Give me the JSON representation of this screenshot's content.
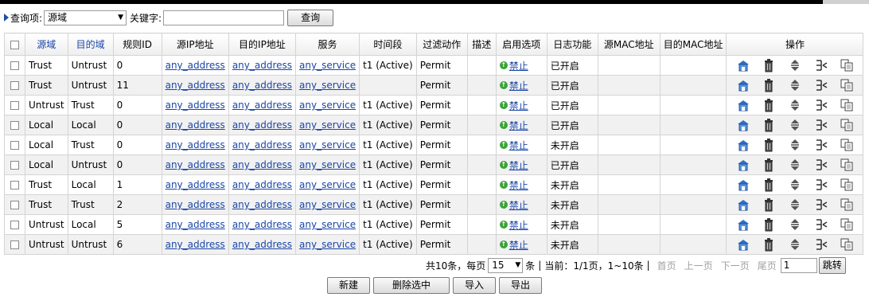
{
  "query": {
    "label": "查询项:",
    "field_value": "源域",
    "keyword_label": "关键字:",
    "keyword_value": "",
    "search_label": "查询"
  },
  "table": {
    "headers": [
      "源域",
      "目的域",
      "规则ID",
      "源IP地址",
      "目的IP地址",
      "服务",
      "时间段",
      "过滤动作",
      "描述",
      "启用选项",
      "日志功能",
      "源MAC地址",
      "目的MAC地址",
      "操作"
    ],
    "rows": [
      {
        "src": "Trust",
        "dst": "Untrust",
        "id": "0",
        "srcip": "any_address",
        "dstip": "any_address",
        "svc": "any_service",
        "time": "t1 (Active)",
        "action": "Permit",
        "desc": "",
        "enable": "禁止",
        "log": "已开启",
        "smac": "",
        "dmac": ""
      },
      {
        "src": "Trust",
        "dst": "Untrust",
        "id": "11",
        "srcip": "any_address",
        "dstip": "any_address",
        "svc": "any_service",
        "time": "",
        "action": "Permit",
        "desc": "",
        "enable": "禁止",
        "log": "已开启",
        "smac": "",
        "dmac": ""
      },
      {
        "src": "Untrust",
        "dst": "Trust",
        "id": "0",
        "srcip": "any_address",
        "dstip": "any_address",
        "svc": "any_service",
        "time": "t1 (Active)",
        "action": "Permit",
        "desc": "",
        "enable": "禁止",
        "log": "已开启",
        "smac": "",
        "dmac": ""
      },
      {
        "src": "Local",
        "dst": "Local",
        "id": "0",
        "srcip": "any_address",
        "dstip": "any_address",
        "svc": "any_service",
        "time": "t1 (Active)",
        "action": "Permit",
        "desc": "",
        "enable": "禁止",
        "log": "已开启",
        "smac": "",
        "dmac": ""
      },
      {
        "src": "Local",
        "dst": "Trust",
        "id": "0",
        "srcip": "any_address",
        "dstip": "any_address",
        "svc": "any_service",
        "time": "t1 (Active)",
        "action": "Permit",
        "desc": "",
        "enable": "禁止",
        "log": "未开启",
        "smac": "",
        "dmac": ""
      },
      {
        "src": "Local",
        "dst": "Untrust",
        "id": "0",
        "srcip": "any_address",
        "dstip": "any_address",
        "svc": "any_service",
        "time": "t1 (Active)",
        "action": "Permit",
        "desc": "",
        "enable": "禁止",
        "log": "已开启",
        "smac": "",
        "dmac": ""
      },
      {
        "src": "Trust",
        "dst": "Local",
        "id": "1",
        "srcip": "any_address",
        "dstip": "any_address",
        "svc": "any_service",
        "time": "t1 (Active)",
        "action": "Permit",
        "desc": "",
        "enable": "禁止",
        "log": "未开启",
        "smac": "",
        "dmac": ""
      },
      {
        "src": "Trust",
        "dst": "Trust",
        "id": "2",
        "srcip": "any_address",
        "dstip": "any_address",
        "svc": "any_service",
        "time": "t1 (Active)",
        "action": "Permit",
        "desc": "",
        "enable": "禁止",
        "log": "未开启",
        "smac": "",
        "dmac": ""
      },
      {
        "src": "Untrust",
        "dst": "Local",
        "id": "5",
        "srcip": "any_address",
        "dstip": "any_address",
        "svc": "any_service",
        "time": "t1 (Active)",
        "action": "Permit",
        "desc": "",
        "enable": "禁止",
        "log": "未开启",
        "smac": "",
        "dmac": ""
      },
      {
        "src": "Untrust",
        "dst": "Untrust",
        "id": "6",
        "srcip": "any_address",
        "dstip": "any_address",
        "svc": "any_service",
        "time": "t1 (Active)",
        "action": "Permit",
        "desc": "",
        "enable": "禁止",
        "log": "未开启",
        "smac": "",
        "dmac": ""
      }
    ],
    "row_icons": [
      "edit-icon",
      "delete-icon",
      "move-icon",
      "insert-icon",
      "copy-icon"
    ],
    "colors": {
      "link": "#1a46a8",
      "enabled_icon": "#3aa336",
      "alt_row": "#f1f1f1"
    }
  },
  "pager": {
    "total_text": "共10条，每页",
    "page_size": "15",
    "unit_text": "条",
    "current_text": "当前：1/1页，1~10条",
    "first": "首页",
    "prev": "上一页",
    "next": "下一页",
    "last": "尾页",
    "goto_value": "1",
    "goto_label": "跳转"
  },
  "actions": {
    "new_label": "新建",
    "delete_selected_label": "删除选中",
    "import_label": "导入",
    "export_label": "导出"
  }
}
